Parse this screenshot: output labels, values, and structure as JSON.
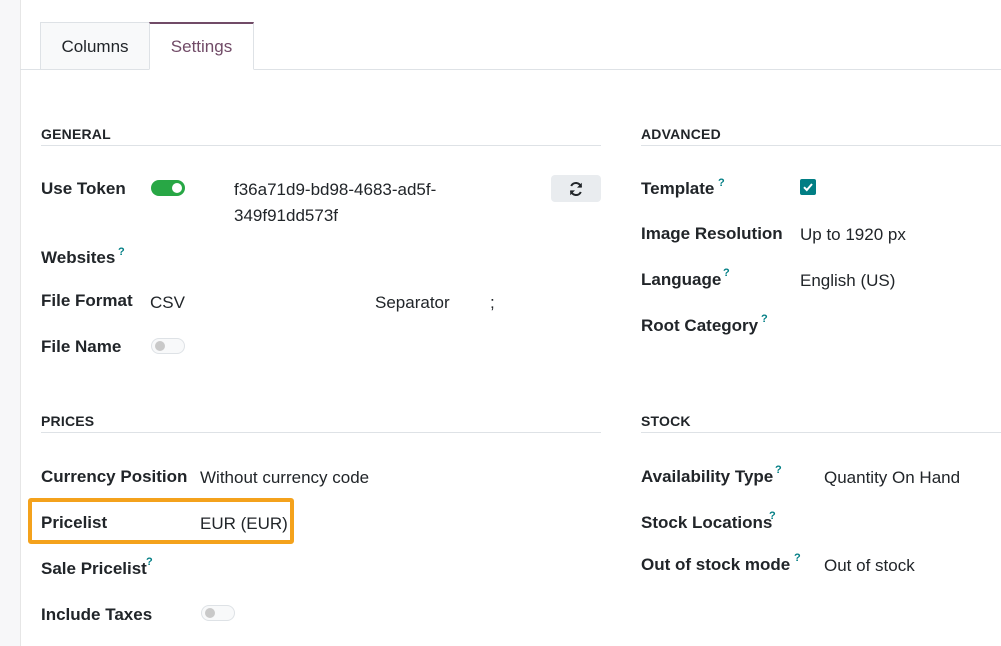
{
  "tabs": [
    {
      "label": "Columns",
      "active": false
    },
    {
      "label": "Settings",
      "active": true
    }
  ],
  "general": {
    "title": "GENERAL",
    "use_token": {
      "label": "Use Token",
      "enabled": true,
      "token_line1": "f36a71d9-bd98-4683-ad5f-",
      "token_line2": "349f91dd573f",
      "refresh_icon": "refresh-icon"
    },
    "websites": {
      "label": "Websites",
      "help": "?"
    },
    "file_format": {
      "label": "File Format",
      "value": "CSV",
      "separator_label": "Separator",
      "separator_value": ";"
    },
    "file_name": {
      "label": "File Name",
      "enabled": false
    }
  },
  "advanced": {
    "title": "ADVANCED",
    "template": {
      "label": "Template",
      "help": "?",
      "checked": true
    },
    "image_resolution": {
      "label": "Image Resolution",
      "value": "Up to 1920 px"
    },
    "language": {
      "label": "Language",
      "help": "?",
      "value": "English (US)"
    },
    "root_category": {
      "label": "Root Category",
      "help": "?"
    }
  },
  "prices": {
    "title": "PRICES",
    "currency_position": {
      "label": "Currency Position",
      "value": "Without currency code"
    },
    "pricelist": {
      "label": "Pricelist",
      "value": "EUR (EUR)"
    },
    "sale_pricelist": {
      "label": "Sale Pricelist",
      "help": "?"
    },
    "include_taxes": {
      "label": "Include Taxes",
      "enabled": false
    }
  },
  "stock": {
    "title": "STOCK",
    "availability_type": {
      "label": "Availability Type",
      "help": "?",
      "value": "Quantity On Hand"
    },
    "stock_locations": {
      "label": "Stock Locations",
      "help": "?"
    },
    "out_of_stock_mode": {
      "label": "Out of stock mode",
      "help": "?",
      "value": "Out of stock"
    }
  },
  "colors": {
    "accent": "#714b67",
    "toggle_on": "#28a745",
    "checkbox": "#017e84",
    "help": "#017e84",
    "highlight": "#f4a21c"
  }
}
